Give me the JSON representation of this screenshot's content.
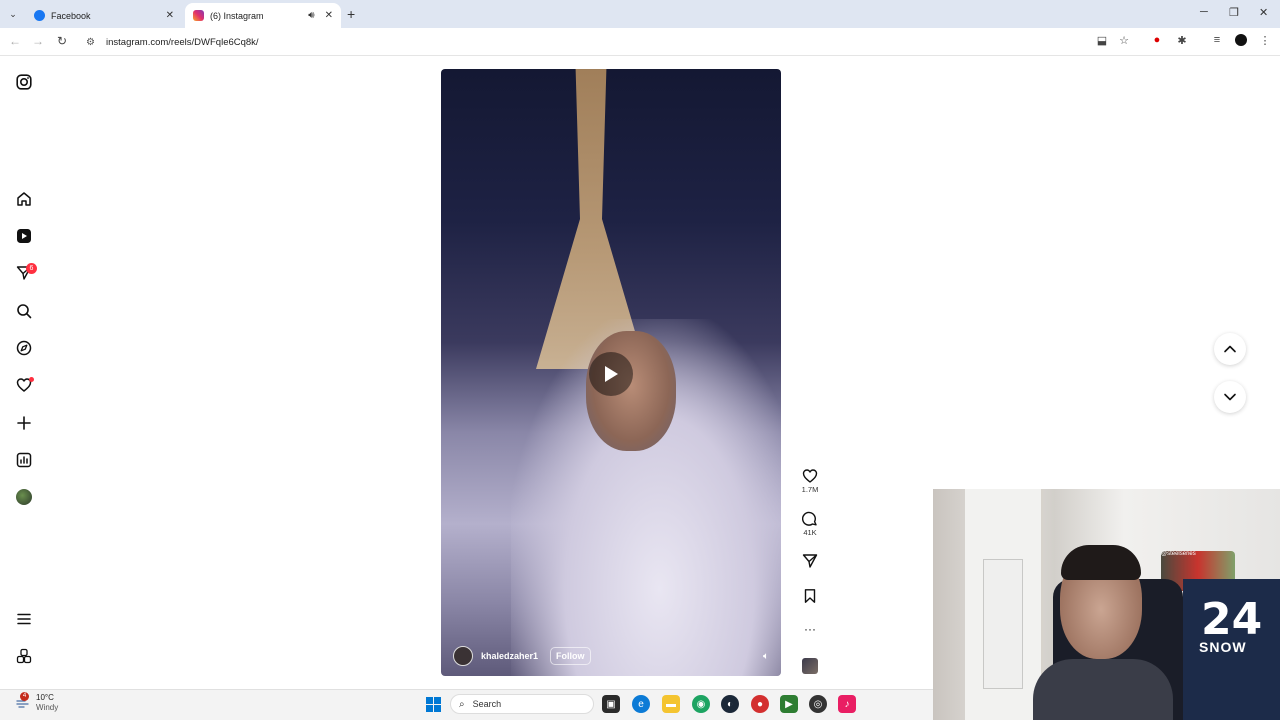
{
  "browser": {
    "tabs": [
      {
        "title": "Facebook",
        "favicon_color": "#1877f2",
        "active": false
      },
      {
        "title": "(6) Instagram",
        "favicon_color": "#e1306c",
        "active": true
      }
    ],
    "url": "instagram.com/reels/DWFqle6Cq8k/"
  },
  "sidebar": {
    "items": [
      {
        "name": "instagram-logo-icon"
      },
      {
        "name": "home-icon"
      },
      {
        "name": "reels-icon"
      },
      {
        "name": "direct-messages-icon",
        "badge": "6"
      },
      {
        "name": "search-icon"
      },
      {
        "name": "explore-icon"
      },
      {
        "name": "notifications-icon"
      },
      {
        "name": "create-icon"
      },
      {
        "name": "dashboard-icon"
      },
      {
        "name": "profile-avatar"
      },
      {
        "name": "more-menu-icon"
      },
      {
        "name": "also-from-meta-icon"
      }
    ]
  },
  "reel": {
    "author": "khaledzaher1",
    "follow_label": "Follow",
    "likes": "1.7M",
    "comments": "41K"
  },
  "webcam": {
    "jersey_number": "24",
    "jersey_name": "SNOW",
    "brand": "@steelseries"
  },
  "taskbar": {
    "temperature": "10°C",
    "condition": "Windy",
    "notification_count": "4",
    "search_placeholder": "Search"
  }
}
